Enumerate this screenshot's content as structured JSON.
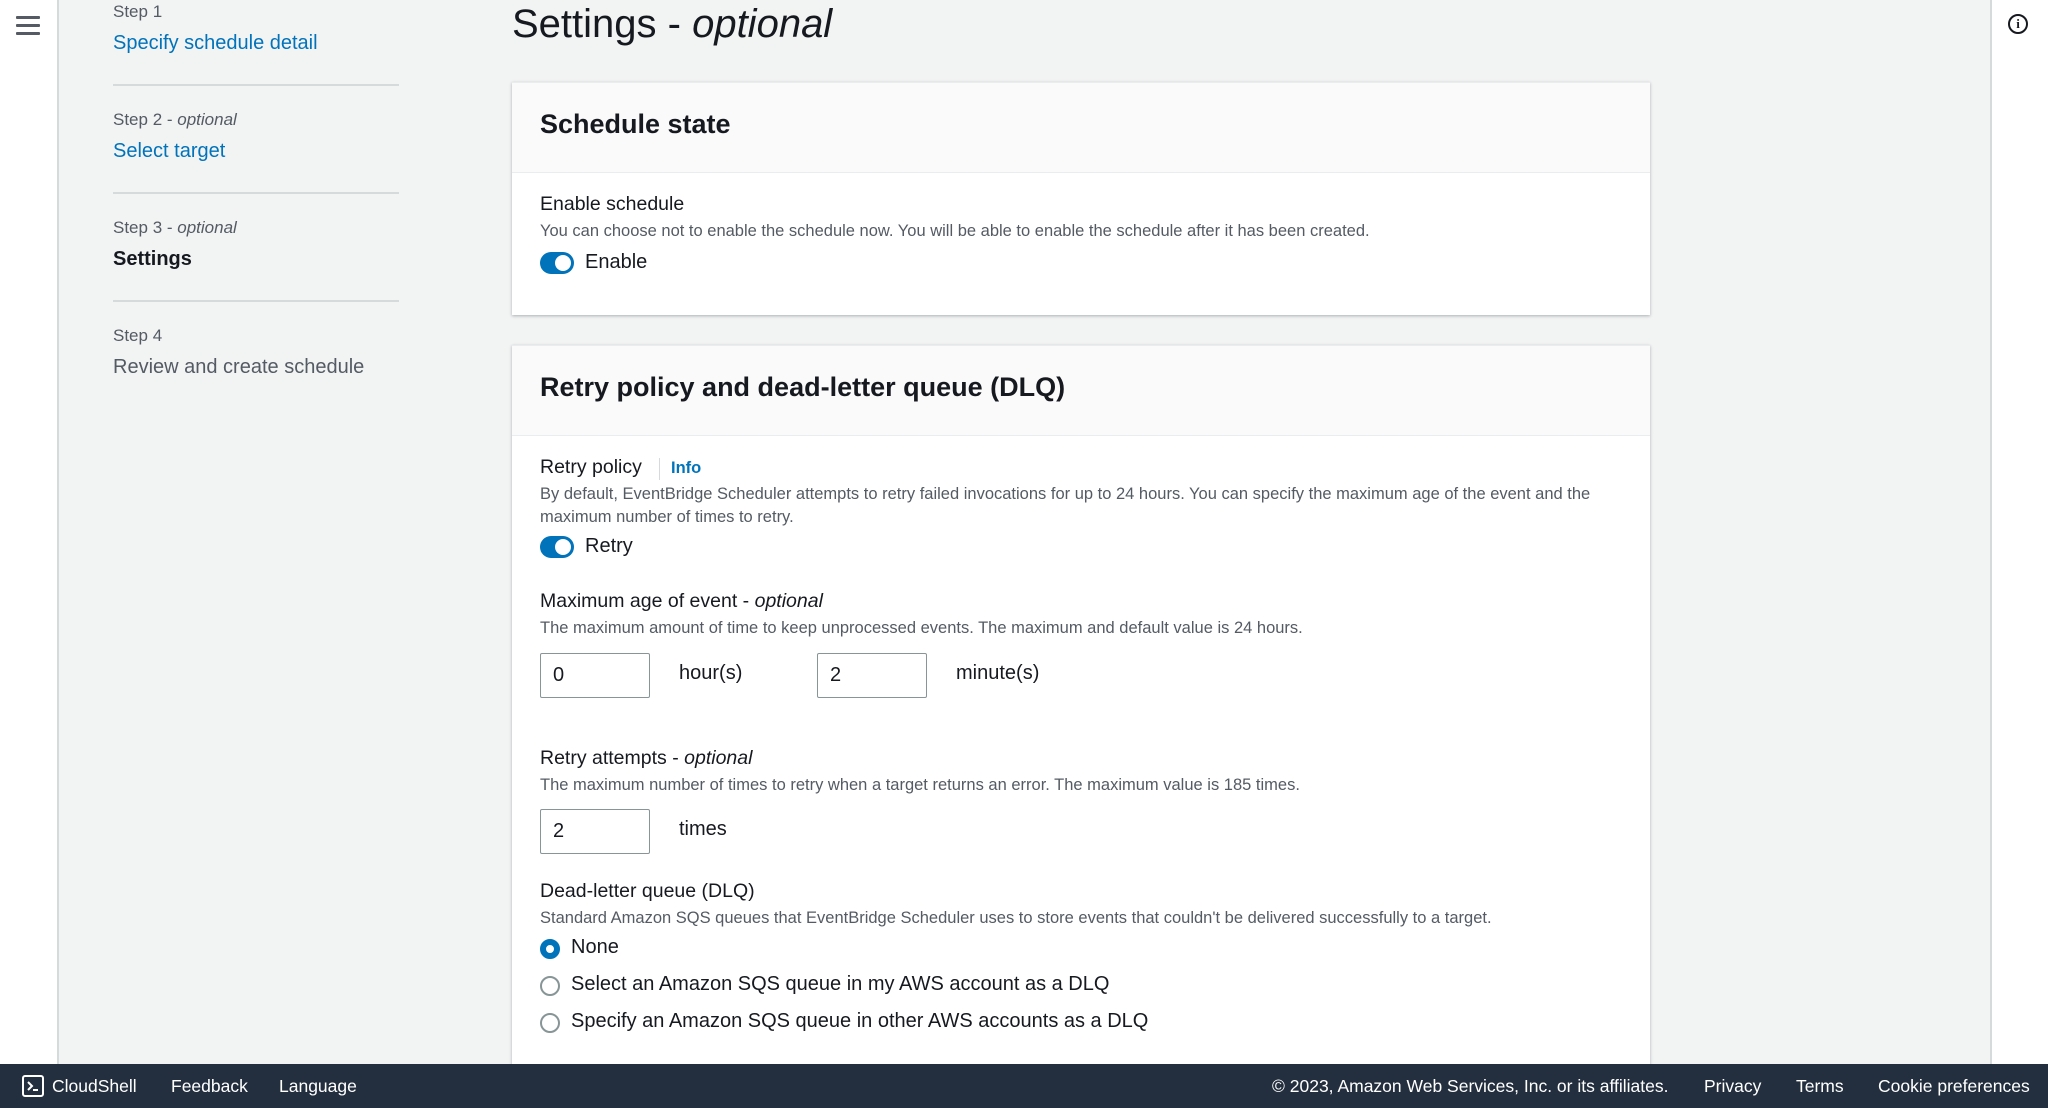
{
  "steps": [
    {
      "label": "Step 1",
      "label_optional": "",
      "name": "Specify schedule detail",
      "state": "link"
    },
    {
      "label": "Step 2 - ",
      "label_optional": "optional",
      "name": "Select target",
      "state": "link"
    },
    {
      "label": "Step 3 - ",
      "label_optional": "optional",
      "name": "Settings",
      "state": "current"
    },
    {
      "label": "Step 4",
      "label_optional": "",
      "name": "Review and create schedule",
      "state": "disabled"
    }
  ],
  "page": {
    "title": "Settings - ",
    "title_optional": "optional"
  },
  "schedule_state": {
    "header": "Schedule state",
    "enable_label": "Enable schedule",
    "enable_desc": "You can choose not to enable the schedule now. You will be able to enable the schedule after it has been created.",
    "toggle_label": "Enable"
  },
  "retry": {
    "header": "Retry policy and dead-letter queue (DLQ)",
    "policy_label": "Retry policy",
    "info": "Info",
    "policy_desc": "By default, EventBridge Scheduler attempts to retry failed invocations for up to 24 hours. You can specify the maximum age of the event and the maximum number of times to retry.",
    "toggle_label": "Retry",
    "max_age_label": "Maximum age of event - ",
    "max_age_optional": "optional",
    "max_age_desc": "The maximum amount of time to keep unprocessed events. The maximum and default value is 24 hours.",
    "hours_value": "0",
    "hours_unit": "hour(s)",
    "minutes_value": "2",
    "minutes_unit": "minute(s)",
    "attempts_label": "Retry attempts - ",
    "attempts_optional": "optional",
    "attempts_desc": "The maximum number of times to retry when a target returns an error. The maximum value is 185 times.",
    "attempts_value": "2",
    "attempts_unit": "times",
    "dlq_label": "Dead-letter queue (DLQ)",
    "dlq_desc": "Standard Amazon SQS queues that EventBridge Scheduler uses to store events that couldn't be delivered successfully to a target.",
    "dlq_options": [
      "None",
      "Select an Amazon SQS queue in my AWS account as a DLQ",
      "Specify an Amazon SQS queue in other AWS accounts as a DLQ"
    ]
  },
  "footer": {
    "cloudshell": "CloudShell",
    "feedback": "Feedback",
    "language": "Language",
    "copyright": "© 2023, Amazon Web Services, Inc. or its affiliates.",
    "privacy": "Privacy",
    "terms": "Terms",
    "cookie": "Cookie preferences"
  },
  "colors": {
    "accent": "#0073bb",
    "footer_bg": "#232f3e",
    "page_bg": "#f2f3f3"
  }
}
